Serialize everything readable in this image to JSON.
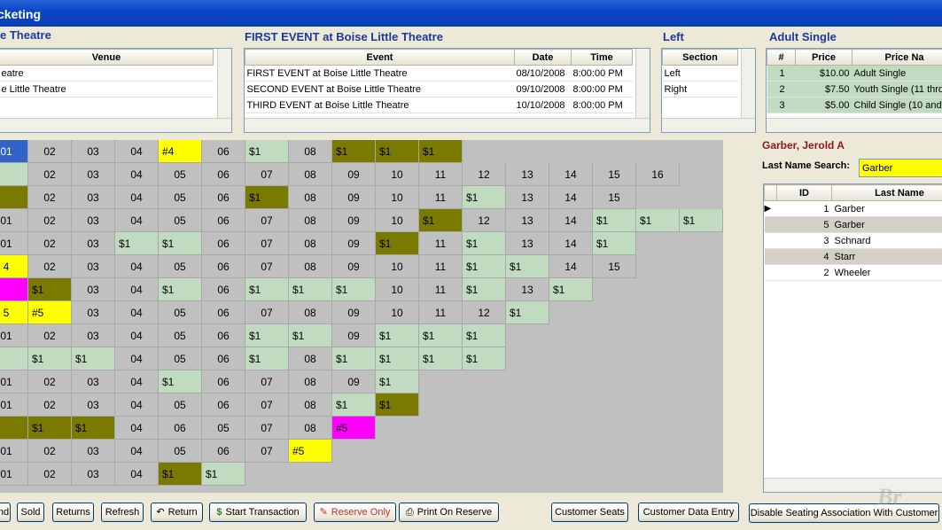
{
  "window": {
    "title": "cketing"
  },
  "headers": {
    "venue": "e Theatre",
    "event": "FIRST EVENT at Boise Little Theatre",
    "section": "Left",
    "price": "Adult Single"
  },
  "venue_grid": {
    "column": "Venue",
    "rows": [
      "eatre",
      "e Little Theatre"
    ]
  },
  "event_grid": {
    "columns": [
      "Event",
      "Date",
      "Time"
    ],
    "rows": [
      [
        "FIRST EVENT at Boise Little Theatre",
        "08/10/2008",
        "8:00:00 PM"
      ],
      [
        "SECOND EVENT at Boise Little Theatre",
        "09/10/2008",
        "8:00:00 PM"
      ],
      [
        "THIRD EVENT at Boise Little Theatre",
        "10/10/2008",
        "8:00:00 PM"
      ]
    ]
  },
  "section_grid": {
    "column": "Section",
    "rows": [
      "Left",
      "Right"
    ]
  },
  "price_grid": {
    "columns": [
      "#",
      "Price",
      "Price Na"
    ],
    "rows": [
      [
        "1",
        "$10.00",
        "Adult Single"
      ],
      [
        "2",
        "$7.50",
        "Youth Single (11 thro"
      ],
      [
        "3",
        "$5.00",
        "Child Single (10 and u"
      ]
    ]
  },
  "seat_colors": {
    "n": "#c0c0c0",
    "a": "#c1dbc1",
    "o": "#7a7a00",
    "y": "#ffff00",
    "m": "#ff00ff",
    "b": "#3163c9"
  },
  "seats": [
    [
      [
        "01",
        "b"
      ],
      [
        "02",
        "n"
      ],
      [
        "03",
        "n"
      ],
      [
        "04",
        "n"
      ],
      [
        "#4",
        "y"
      ],
      [
        "06",
        "n"
      ],
      [
        "$1",
        "a"
      ],
      [
        "08",
        "n"
      ],
      [
        "$1",
        "o"
      ],
      [
        "$1",
        "o"
      ],
      [
        "$1",
        "o"
      ]
    ],
    [
      [
        "",
        "a"
      ],
      [
        "02",
        "n"
      ],
      [
        "03",
        "n"
      ],
      [
        "04",
        "n"
      ],
      [
        "05",
        "n"
      ],
      [
        "06",
        "n"
      ],
      [
        "07",
        "n"
      ],
      [
        "08",
        "n"
      ],
      [
        "09",
        "n"
      ],
      [
        "10",
        "n"
      ],
      [
        "11",
        "n"
      ],
      [
        "12",
        "n"
      ],
      [
        "13",
        "n"
      ],
      [
        "14",
        "n"
      ],
      [
        "15",
        "n"
      ],
      [
        "16",
        "n"
      ]
    ],
    [
      [
        "",
        "o"
      ],
      [
        "02",
        "n"
      ],
      [
        "03",
        "n"
      ],
      [
        "04",
        "n"
      ],
      [
        "05",
        "n"
      ],
      [
        "06",
        "n"
      ],
      [
        "$1",
        "o"
      ],
      [
        "08",
        "n"
      ],
      [
        "09",
        "n"
      ],
      [
        "10",
        "n"
      ],
      [
        "11",
        "n"
      ],
      [
        "$1",
        "a"
      ],
      [
        "13",
        "n"
      ],
      [
        "14",
        "n"
      ],
      [
        "15",
        "n"
      ]
    ],
    [
      [
        "01",
        "n"
      ],
      [
        "02",
        "n"
      ],
      [
        "03",
        "n"
      ],
      [
        "04",
        "n"
      ],
      [
        "05",
        "n"
      ],
      [
        "06",
        "n"
      ],
      [
        "07",
        "n"
      ],
      [
        "08",
        "n"
      ],
      [
        "09",
        "n"
      ],
      [
        "10",
        "n"
      ],
      [
        "$1",
        "o"
      ],
      [
        "12",
        "n"
      ],
      [
        "13",
        "n"
      ],
      [
        "14",
        "n"
      ],
      [
        "$1",
        "a"
      ],
      [
        "$1",
        "a"
      ],
      [
        "$1",
        "a"
      ]
    ],
    [
      [
        "01",
        "n"
      ],
      [
        "02",
        "n"
      ],
      [
        "03",
        "n"
      ],
      [
        "$1",
        "a"
      ],
      [
        "$1",
        "a"
      ],
      [
        "06",
        "n"
      ],
      [
        "07",
        "n"
      ],
      [
        "08",
        "n"
      ],
      [
        "09",
        "n"
      ],
      [
        "$1",
        "o"
      ],
      [
        "11",
        "n"
      ],
      [
        "$1",
        "a"
      ],
      [
        "13",
        "n"
      ],
      [
        "14",
        "n"
      ],
      [
        "$1",
        "a"
      ]
    ],
    [
      [
        "4",
        "y"
      ],
      [
        "02",
        "n"
      ],
      [
        "03",
        "n"
      ],
      [
        "04",
        "n"
      ],
      [
        "05",
        "n"
      ],
      [
        "06",
        "n"
      ],
      [
        "07",
        "n"
      ],
      [
        "08",
        "n"
      ],
      [
        "09",
        "n"
      ],
      [
        "10",
        "n"
      ],
      [
        "11",
        "n"
      ],
      [
        "$1",
        "a"
      ],
      [
        "$1",
        "a"
      ],
      [
        "14",
        "n"
      ],
      [
        "15",
        "n"
      ]
    ],
    [
      [
        "#",
        "m"
      ],
      [
        "$1",
        "o"
      ],
      [
        "03",
        "n"
      ],
      [
        "04",
        "n"
      ],
      [
        "$1",
        "a"
      ],
      [
        "06",
        "n"
      ],
      [
        "$1",
        "a"
      ],
      [
        "$1",
        "a"
      ],
      [
        "$1",
        "a"
      ],
      [
        "10",
        "n"
      ],
      [
        "11",
        "n"
      ],
      [
        "$1",
        "a"
      ],
      [
        "13",
        "n"
      ],
      [
        "$1",
        "a"
      ]
    ],
    [
      [
        "5",
        "y"
      ],
      [
        "#5",
        "y"
      ],
      [
        "03",
        "n"
      ],
      [
        "04",
        "n"
      ],
      [
        "05",
        "n"
      ],
      [
        "06",
        "n"
      ],
      [
        "07",
        "n"
      ],
      [
        "08",
        "n"
      ],
      [
        "09",
        "n"
      ],
      [
        "10",
        "n"
      ],
      [
        "11",
        "n"
      ],
      [
        "12",
        "n"
      ],
      [
        "$1",
        "a"
      ]
    ],
    [
      [
        "01",
        "n"
      ],
      [
        "02",
        "n"
      ],
      [
        "03",
        "n"
      ],
      [
        "04",
        "n"
      ],
      [
        "05",
        "n"
      ],
      [
        "06",
        "n"
      ],
      [
        "$1",
        "a"
      ],
      [
        "$1",
        "a"
      ],
      [
        "09",
        "n"
      ],
      [
        "$1",
        "a"
      ],
      [
        "$1",
        "a"
      ],
      [
        "$1",
        "a"
      ]
    ],
    [
      [
        "",
        "a"
      ],
      [
        "$1",
        "a"
      ],
      [
        "$1",
        "a"
      ],
      [
        "04",
        "n"
      ],
      [
        "05",
        "n"
      ],
      [
        "06",
        "n"
      ],
      [
        "$1",
        "a"
      ],
      [
        "08",
        "n"
      ],
      [
        "$1",
        "a"
      ],
      [
        "$1",
        "a"
      ],
      [
        "$1",
        "a"
      ],
      [
        "$1",
        "a"
      ]
    ],
    [
      [
        "01",
        "n"
      ],
      [
        "02",
        "n"
      ],
      [
        "03",
        "n"
      ],
      [
        "04",
        "n"
      ],
      [
        "$1",
        "a"
      ],
      [
        "06",
        "n"
      ],
      [
        "07",
        "n"
      ],
      [
        "08",
        "n"
      ],
      [
        "09",
        "n"
      ],
      [
        "$1",
        "a"
      ]
    ],
    [
      [
        "01",
        "n"
      ],
      [
        "02",
        "n"
      ],
      [
        "03",
        "n"
      ],
      [
        "04",
        "n"
      ],
      [
        "05",
        "n"
      ],
      [
        "06",
        "n"
      ],
      [
        "07",
        "n"
      ],
      [
        "08",
        "n"
      ],
      [
        "$1",
        "a"
      ],
      [
        "$1",
        "o"
      ]
    ],
    [
      [
        "",
        "o"
      ],
      [
        "$1",
        "o"
      ],
      [
        "$1",
        "o"
      ],
      [
        "04",
        "n"
      ],
      [
        "06",
        "n"
      ],
      [
        "05",
        "n"
      ],
      [
        "07",
        "n"
      ],
      [
        "08",
        "n"
      ],
      [
        "#5",
        "m"
      ]
    ],
    [
      [
        "01",
        "n"
      ],
      [
        "02",
        "n"
      ],
      [
        "03",
        "n"
      ],
      [
        "04",
        "n"
      ],
      [
        "05",
        "n"
      ],
      [
        "06",
        "n"
      ],
      [
        "07",
        "n"
      ],
      [
        "#5",
        "y"
      ]
    ],
    [
      [
        "01",
        "n"
      ],
      [
        "02",
        "n"
      ],
      [
        "03",
        "n"
      ],
      [
        "04",
        "n"
      ],
      [
        "$1",
        "o"
      ],
      [
        "$1",
        "a"
      ]
    ]
  ],
  "customer": {
    "name": "Garber, Jerold A",
    "search_label": "Last Name Search:",
    "search_value": "Garber",
    "columns": [
      "ID",
      "Last Name"
    ],
    "rows": [
      [
        "1",
        "Garber"
      ],
      [
        "5",
        "Garber"
      ],
      [
        "3",
        "Schnard"
      ],
      [
        "4",
        "Starr"
      ],
      [
        "2",
        "Wheeler"
      ]
    ]
  },
  "buttons": {
    "end": "nd",
    "sold": "Sold",
    "returns": "Returns",
    "refresh": "Refresh",
    "return": "Return",
    "start_transaction": "Start Transaction",
    "reserve_only": "Reserve Only",
    "print_on_reserve": "Print On Reserve",
    "customer_seats": "Customer Seats",
    "customer_data_entry": "Customer Data Entry",
    "disable_assoc": "Disable Seating Association With Customer"
  },
  "watermark": "Br"
}
